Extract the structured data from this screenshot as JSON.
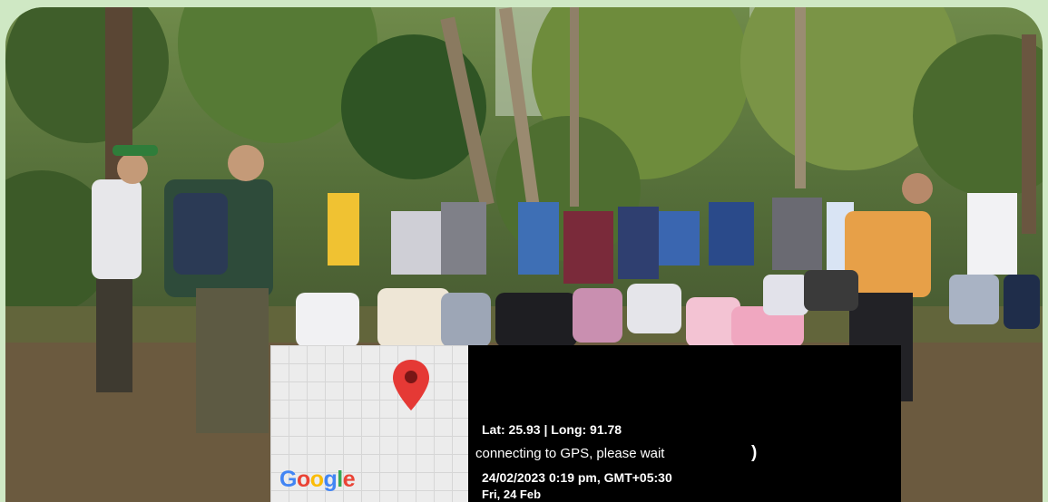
{
  "photo": {
    "subject": "group-photo"
  },
  "overlay": {
    "map_logo": "Google",
    "latlong": "Lat: 25.93 | Long: 91.78",
    "status": "connecting to GPS, please wait",
    "spinner": ")",
    "datetime": "24/02/2023  0:19 pm, GMT+05:30",
    "day": "Fri, 24 Feb"
  },
  "colors": {
    "frame": "#cfe8c4",
    "panel": "#000000",
    "pin": "#e53935"
  }
}
